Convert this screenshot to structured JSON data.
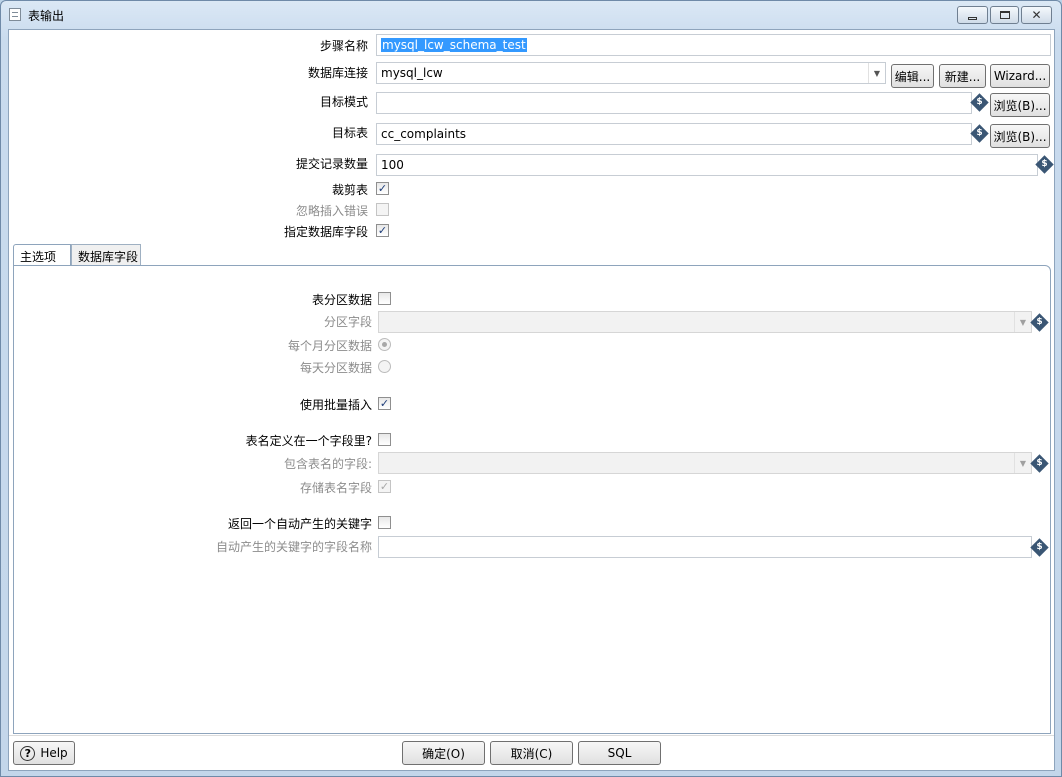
{
  "window": {
    "title": "表输出"
  },
  "form": {
    "step_name_label": "步骤名称",
    "step_name_value": "mysql_lcw_schema_test",
    "connection_label": "数据库连接",
    "connection_value": "mysql_lcw",
    "edit_button": "编辑...",
    "new_button": "新建...",
    "wizard_button": "Wizard...",
    "target_schema_label": "目标模式",
    "target_schema_value": "",
    "browse_schema_button": "浏览(B)...",
    "target_table_label": "目标表",
    "target_table_value": "cc_complaints",
    "browse_table_button": "浏览(B)...",
    "commit_size_label": "提交记录数量",
    "commit_size_value": "100",
    "truncate_label": "裁剪表",
    "truncate_checked": true,
    "ignore_errors_label": "忽略插入错误",
    "ignore_errors_checked": false,
    "specify_fields_label": "指定数据库字段",
    "specify_fields_checked": true
  },
  "tabs": [
    {
      "label": "主选项",
      "active": true
    },
    {
      "label": "数据库字段",
      "active": false
    }
  ],
  "main_options": {
    "partition_label": "表分区数据",
    "partition_field_label": "分区字段",
    "partition_field_value": "",
    "monthly_label": "每个月分区数据",
    "daily_label": "每天分区数据",
    "batch_label": "使用批量插入",
    "table_in_field_label": "表名定义在一个字段里?",
    "table_field_label": "包含表名的字段:",
    "table_field_value": "",
    "store_table_label": "存储表名字段",
    "return_key_label": "返回一个自动产生的关键字",
    "key_field_label": "自动产生的关键字的字段名称",
    "key_field_value": ""
  },
  "footer": {
    "help_button": "Help",
    "ok_button": "确定(O)",
    "cancel_button": "取消(C)",
    "sql_button": "SQL"
  },
  "icons": {
    "variable": "variable-diamond-icon",
    "help": "help-circle-icon",
    "title": "dialog-icon"
  }
}
